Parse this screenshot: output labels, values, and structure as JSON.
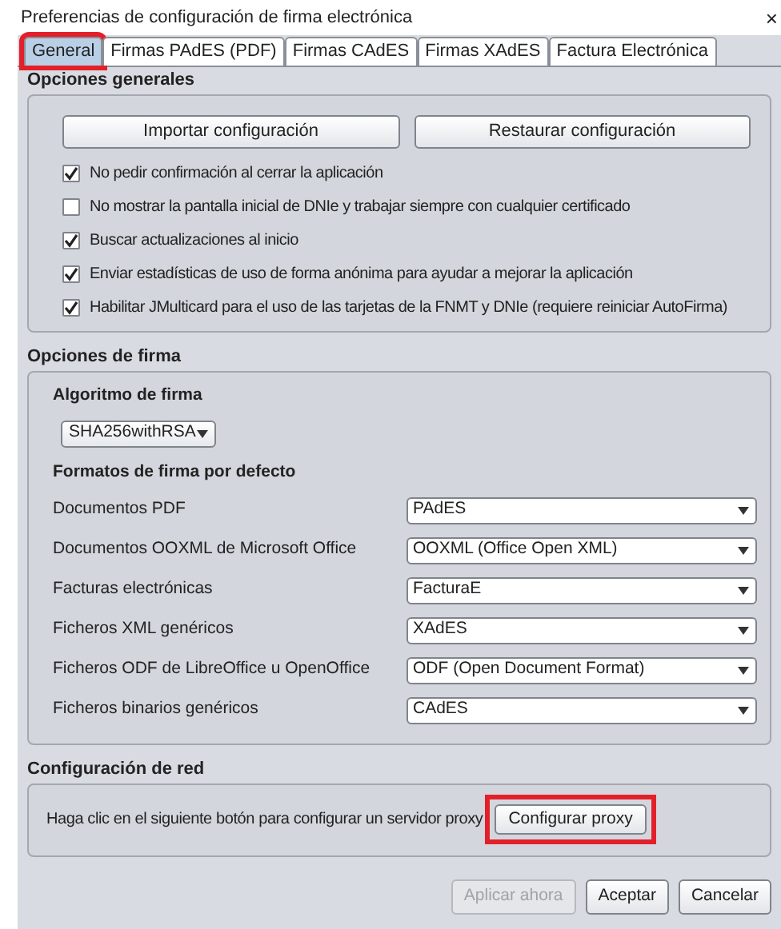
{
  "window": {
    "title": "Preferencias de configuración de firma electrónica",
    "close": "×"
  },
  "tabs": [
    {
      "label": "General",
      "selected": true,
      "highlighted": true
    },
    {
      "label": "Firmas PAdES (PDF)",
      "selected": false,
      "highlighted": false
    },
    {
      "label": "Firmas CAdES",
      "selected": false,
      "highlighted": false
    },
    {
      "label": "Firmas XAdES",
      "selected": false,
      "highlighted": false
    },
    {
      "label": "Factura Electrónica",
      "selected": false,
      "highlighted": false
    }
  ],
  "general": {
    "title": "Opciones generales",
    "buttons": [
      "Importar configuración",
      "Restaurar configuración"
    ],
    "options": [
      {
        "label": "No pedir confirmación al cerrar la aplicación",
        "checked": true
      },
      {
        "label": "No mostrar la pantalla inicial de DNIe y trabajar siempre con cualquier certificado",
        "checked": false
      },
      {
        "label": "Buscar actualizaciones al inicio",
        "checked": true
      },
      {
        "label": "Enviar estadísticas de uso de forma anónima para ayudar a mejorar la aplicación",
        "checked": true
      },
      {
        "label": "Habilitar JMulticard para el uso de las tarjetas de la FNMT y DNIe (requiere reiniciar AutoFirma)",
        "checked": true
      }
    ]
  },
  "signature": {
    "title": "Opciones de firma",
    "algorithm_label": "Algoritmo de firma",
    "algorithm": "SHA256withRSA",
    "formats_label": "Formatos de firma por defecto",
    "formats": [
      {
        "label": "Documentos PDF",
        "value": "PAdES"
      },
      {
        "label": "Documentos OOXML de Microsoft Office",
        "value": "OOXML (Office Open XML)"
      },
      {
        "label": "Facturas electrónicas",
        "value": "FacturaE"
      },
      {
        "label": "Ficheros XML genéricos",
        "value": "XAdES"
      },
      {
        "label": "Ficheros ODF de LibreOffice u OpenOffice",
        "value": "ODF (Open Document Format)"
      },
      {
        "label": "Ficheros binarios genéricos",
        "value": "CAdES"
      }
    ]
  },
  "network": {
    "title": "Configuración de red",
    "text": "Haga clic en el siguiente botón para configurar un servidor proxy",
    "button": "Configurar proxy",
    "highlighted": true
  },
  "footer": [
    {
      "label": "Aplicar ahora",
      "disabled": true
    },
    {
      "label": "Aceptar",
      "disabled": false
    },
    {
      "label": "Cancelar",
      "disabled": false
    }
  ]
}
